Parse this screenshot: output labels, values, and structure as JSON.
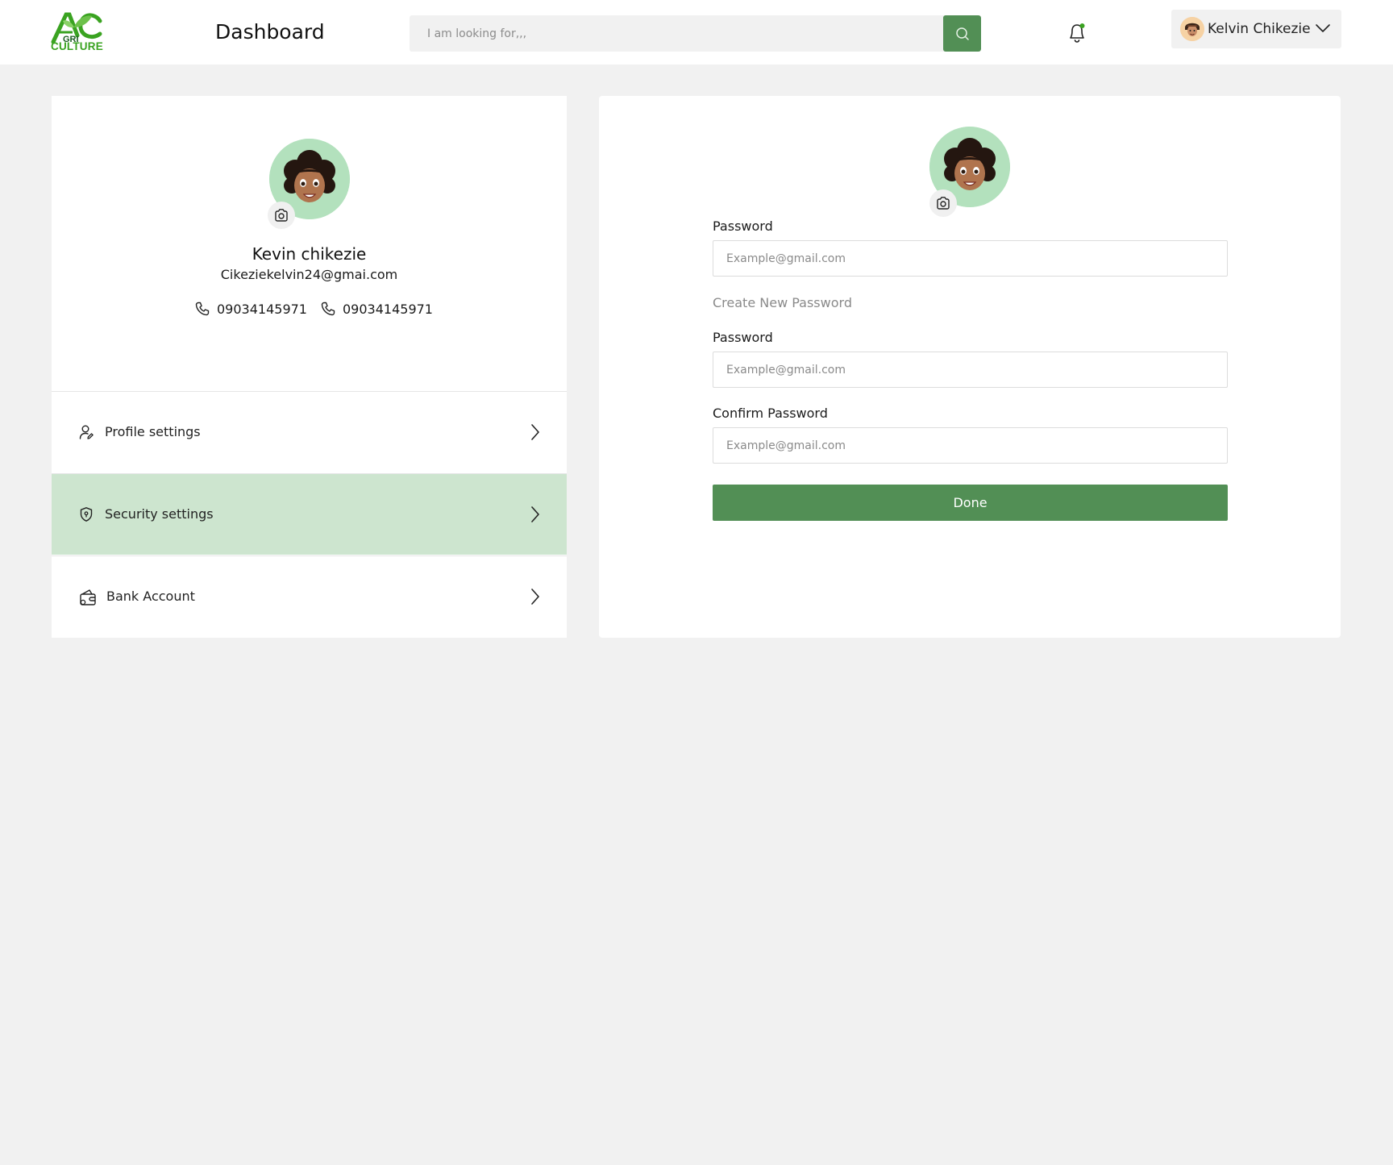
{
  "header": {
    "logo_text": "CULTURE",
    "logo_mark_text": "GRI",
    "title": "Dashboard",
    "search_placeholder": "I am looking for,,,",
    "user_name": "Kelvin Chikezie"
  },
  "profile": {
    "name": "Kevin chikezie",
    "email": "Cikeziekelvin24@gmai.com",
    "phones": [
      "09034145971",
      "09034145971"
    ]
  },
  "menu": [
    {
      "label": "Profile settings",
      "icon": "user-edit-icon",
      "active": false
    },
    {
      "label": "Security settings",
      "icon": "shield-icon",
      "active": true
    },
    {
      "label": "Bank Account",
      "icon": "wallet-icon",
      "active": false
    }
  ],
  "security_form": {
    "current_password_label": "Password",
    "current_password_placeholder": "Example@gmail.com",
    "section_note": "Create New Password",
    "new_password_label": "Password",
    "new_password_placeholder": "Example@gmail.com",
    "confirm_password_label": "Confirm Password",
    "confirm_password_placeholder": "Example@gmail.com",
    "submit_label": "Done"
  },
  "colors": {
    "brand_green": "#528f55",
    "active_menu_bg": "#cde5cf",
    "avatar_bg": "#b3e1bd",
    "page_bg": "#f1f1f1"
  }
}
